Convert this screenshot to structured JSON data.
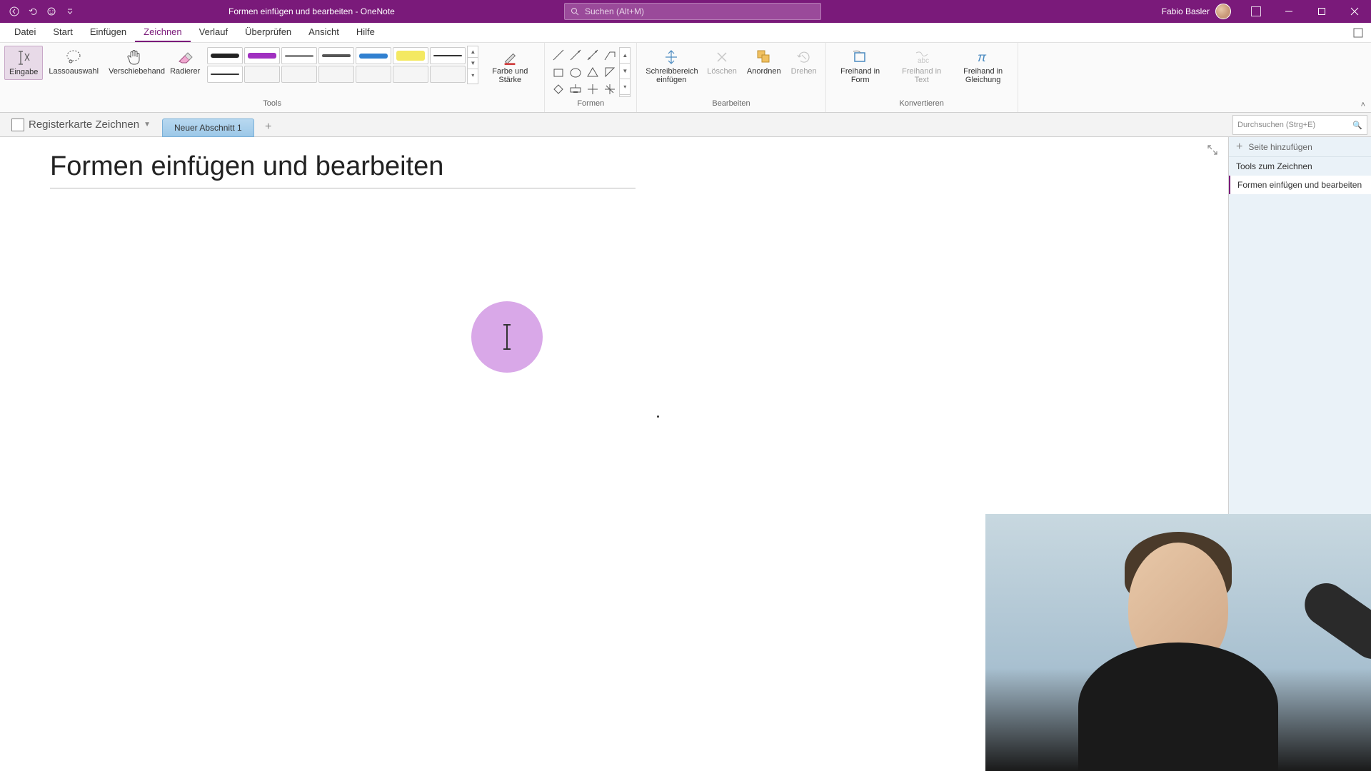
{
  "titlebar": {
    "doc_title": "Formen einfügen und bearbeiten",
    "app_name": "OneNote",
    "separator": "  -  ",
    "search_placeholder": "Suchen (Alt+M)",
    "user_name": "Fabio Basler"
  },
  "ribbon_tabs": [
    "Datei",
    "Start",
    "Einfügen",
    "Zeichnen",
    "Verlauf",
    "Überprüfen",
    "Ansicht",
    "Hilfe"
  ],
  "ribbon_active_tab": 3,
  "ribbon": {
    "tools_group": "Tools",
    "eingabe": "Eingabe",
    "lasso": "Lassoauswahl",
    "verschiebehand": "Verschiebehand",
    "radierer": "Radierer",
    "farbe_staerke": "Farbe und Stärke",
    "formen_group": "Formen",
    "schreibbereich": "Schreibbereich einfügen",
    "loeschen": "Löschen",
    "anordnen": "Anordnen",
    "drehen": "Drehen",
    "bearbeiten_group": "Bearbeiten",
    "freihand_form": "Freihand in Form",
    "freihand_text": "Freihand in Text",
    "freihand_gleichung": "Freihand in Gleichung",
    "konvertieren_group": "Konvertieren"
  },
  "pens": [
    {
      "color": "#222",
      "width": 6
    },
    {
      "color": "#a030c0",
      "width": 8
    },
    {
      "color": "#888",
      "width": 3
    },
    {
      "color": "#555",
      "width": 4
    },
    {
      "color": "#3080d0",
      "width": 7
    },
    {
      "color": "#f0e020",
      "width": 14,
      "hl": true
    },
    {
      "color": "#333",
      "width": 2
    }
  ],
  "notebook": {
    "name": "Registerkarte Zeichnen",
    "section": "Neuer Abschnitt 1"
  },
  "page_panel": {
    "search_placeholder": "Durchsuchen (Strg+E)",
    "add_page": "Seite hinzufügen",
    "pages": [
      "Tools zum Zeichnen",
      "Formen einfügen und bearbeiten"
    ],
    "active_page": 1
  },
  "canvas": {
    "page_title": "Formen einfügen und bearbeiten"
  }
}
